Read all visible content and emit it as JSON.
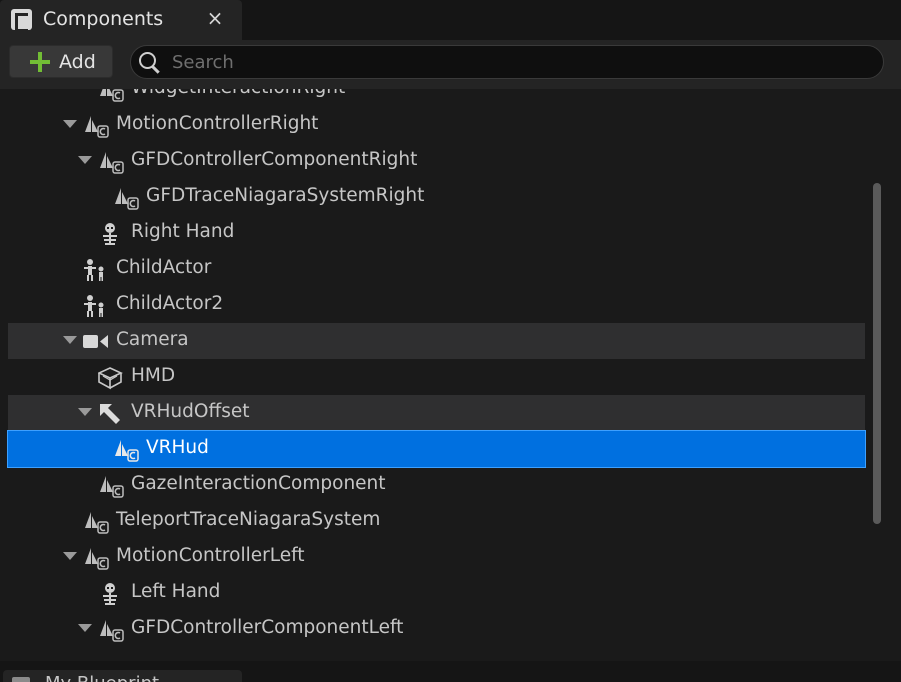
{
  "tab": {
    "title": "Components",
    "close": "×"
  },
  "toolbar": {
    "add_label": "Add",
    "search_placeholder": "Search"
  },
  "tree": {
    "rows": [
      {
        "label": "WidgetInteractionRight",
        "icon": "scene-component-icon"
      },
      {
        "label": "MotionControllerRight",
        "icon": "scene-component-icon",
        "expanded": true
      },
      {
        "label": "GFDControllerComponentRight",
        "icon": "scene-component-icon",
        "expanded": true
      },
      {
        "label": "GFDTraceNiagaraSystemRight",
        "icon": "scene-component-icon"
      },
      {
        "label": "Right Hand",
        "icon": "skeleton-icon"
      },
      {
        "label": "ChildActor",
        "icon": "child-actor-icon"
      },
      {
        "label": "ChildActor2",
        "icon": "child-actor-icon"
      },
      {
        "label": "Camera",
        "icon": "camera-icon",
        "expanded": true,
        "highlighted": true
      },
      {
        "label": "HMD",
        "icon": "static-mesh-icon"
      },
      {
        "label": "VRHudOffset",
        "icon": "arrow-component-icon",
        "expanded": true,
        "highlighted": true
      },
      {
        "label": "VRHud",
        "icon": "scene-component-icon",
        "selected": true
      },
      {
        "label": "GazeInteractionComponent",
        "icon": "scene-component-icon"
      },
      {
        "label": "TeleportTraceNiagaraSystem",
        "icon": "scene-component-icon"
      },
      {
        "label": "MotionControllerLeft",
        "icon": "scene-component-icon",
        "expanded": true
      },
      {
        "label": "Left Hand",
        "icon": "skeleton-icon"
      },
      {
        "label": "GFDControllerComponentLeft",
        "icon": "scene-component-icon",
        "expanded": true
      }
    ]
  },
  "bottom_tab": {
    "label": "My Blueprint"
  },
  "colors": {
    "selection": "#0070e0",
    "add_plus": "#72bd35",
    "panel": "#242424",
    "tree_bg": "#1a1a1a"
  }
}
